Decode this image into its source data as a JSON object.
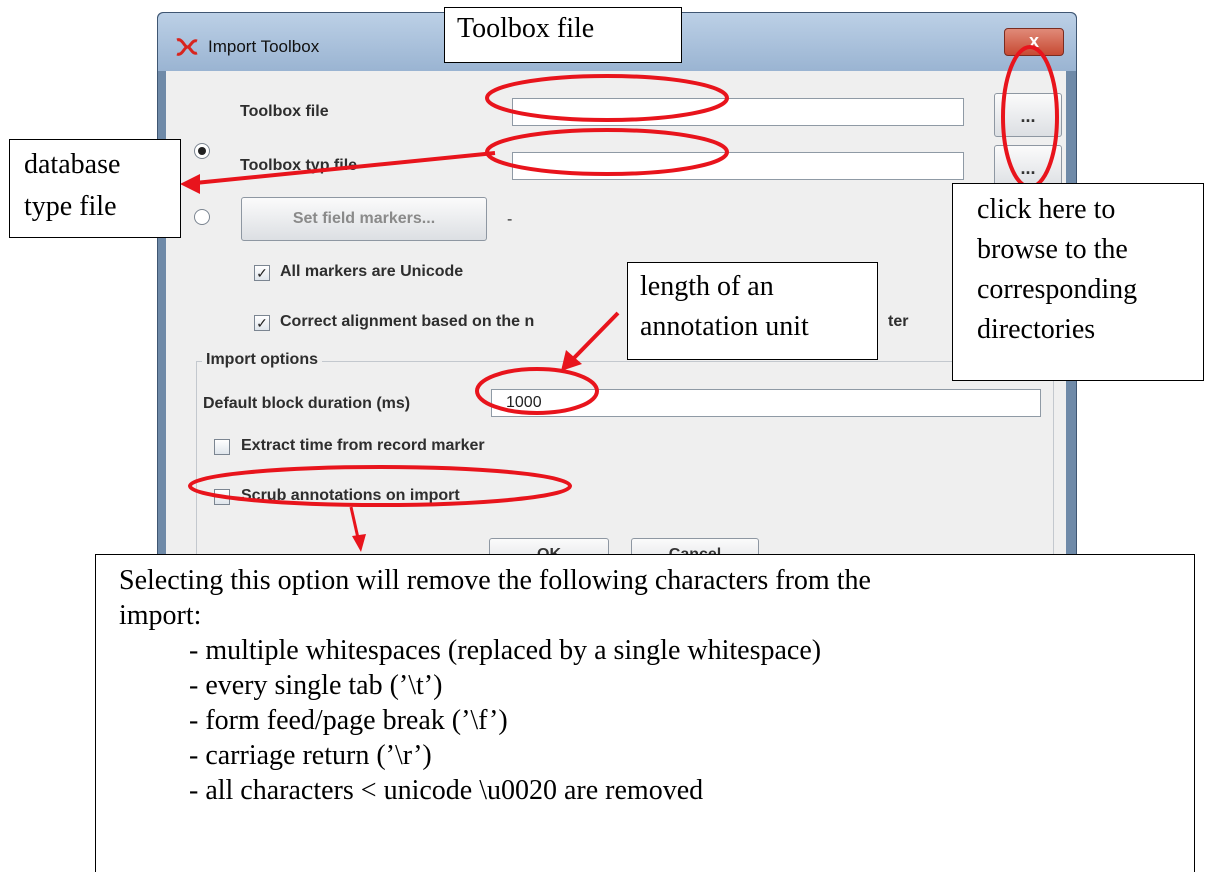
{
  "dialog": {
    "title": "Import Toolbox",
    "close_glyph": "x",
    "toolbox_file_label": "Toolbox file",
    "toolbox_typ_file_label": "Toolbox typ file",
    "browse_label": "...",
    "set_field_markers_label": "Set field markers...",
    "dash": "-",
    "all_markers_unicode_label": "All markers are Unicode",
    "all_markers_unicode_checked": true,
    "correct_alignment_label": "Correct alignment based on the n",
    "correct_alignment_label_tail": "ter",
    "correct_alignment_checked": true,
    "import_options_label": "Import options",
    "default_block_duration_label": "Default block duration (ms)",
    "default_block_duration_value": "1000",
    "extract_time_label": "Extract time from record marker",
    "extract_time_checked": false,
    "scrub_label": "Scrub annotations on import",
    "scrub_checked": false,
    "ok_label": "OK",
    "cancel_label": "Cancel",
    "radio_typ_selected": true,
    "radio_markers_selected": false
  },
  "annotations": {
    "toolbox_file_callout": "Toolbox file",
    "database_type_line1": "database",
    "database_type_line2": "type file",
    "browse_line1": "click here to",
    "browse_line2": "browse to the",
    "browse_line3": "corresponding",
    "browse_line4": "directories",
    "length_line1": "length of an",
    "length_line2": "annotation unit",
    "scrub_title_line1": "Selecting this option will remove the following characters from the",
    "scrub_title_line2": "import:",
    "scrub_items": [
      "- multiple whitespaces (replaced by a single whitespace)",
      "- every single tab (’\\t’)",
      "- form feed/page break (’\\f’)",
      "- carriage return (’\\r’)",
      "- all characters < unicode \\u0020 are removed"
    ],
    "highlight_color": "#e8141c"
  }
}
